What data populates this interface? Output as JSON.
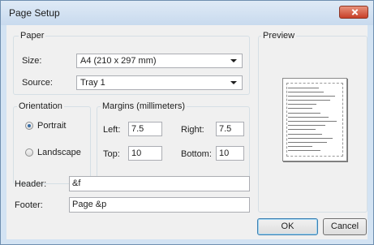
{
  "window": {
    "title": "Page Setup"
  },
  "paper": {
    "group_label": "Paper",
    "size_label": "Size:",
    "size_value": "A4 (210 x 297 mm)",
    "source_label": "Source:",
    "source_value": "Tray 1"
  },
  "orientation": {
    "group_label": "Orientation",
    "portrait_label": "Portrait",
    "landscape_label": "Landscape",
    "selected": "portrait"
  },
  "margins": {
    "group_label": "Margins (millimeters)",
    "left_label": "Left:",
    "left_value": "7.5",
    "right_label": "Right:",
    "right_value": "7.5",
    "top_label": "Top:",
    "top_value": "10",
    "bottom_label": "Bottom:",
    "bottom_value": "10"
  },
  "header": {
    "label": "Header:",
    "value": "&f"
  },
  "footer": {
    "label": "Footer:",
    "value": "Page &p"
  },
  "preview": {
    "label": "Preview"
  },
  "buttons": {
    "ok": "OK",
    "cancel": "Cancel"
  },
  "colors": {
    "title_bar": "#c8daee",
    "close_button": "#c7402a",
    "default_button_border": "#3c7fb1"
  }
}
